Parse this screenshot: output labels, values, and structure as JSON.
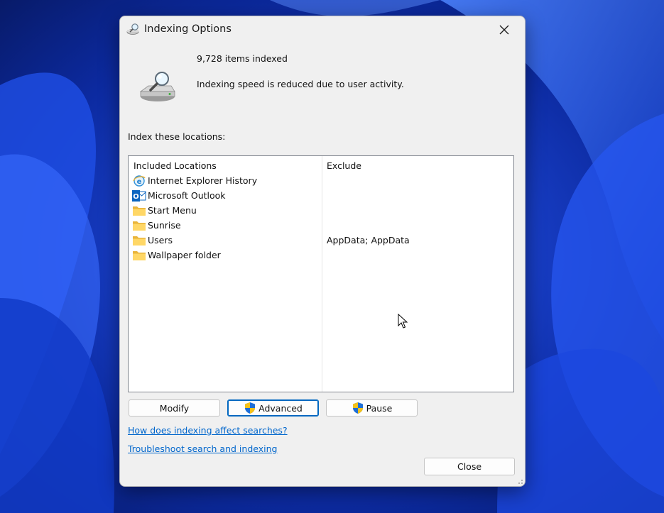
{
  "window": {
    "title": "Indexing Options",
    "icon": "indexing-magnifier-icon"
  },
  "status": {
    "items_indexed": "9,728 items indexed",
    "speed_message": "Indexing speed is reduced due to user activity."
  },
  "locations": {
    "label": "Index these locations:",
    "col_included": "Included Locations",
    "col_exclude": "Exclude",
    "rows": [
      {
        "name": "Internet Explorer History",
        "exclude": "",
        "icon": "internet-explorer-icon"
      },
      {
        "name": "Microsoft Outlook",
        "exclude": "",
        "icon": "outlook-icon"
      },
      {
        "name": "Start Menu",
        "exclude": "",
        "icon": "folder-icon"
      },
      {
        "name": "Sunrise",
        "exclude": "",
        "icon": "folder-icon"
      },
      {
        "name": "Users",
        "exclude": "AppData; AppData",
        "icon": "folder-icon"
      },
      {
        "name": "Wallpaper folder",
        "exclude": "",
        "icon": "folder-icon"
      }
    ]
  },
  "buttons": {
    "modify": "Modify",
    "advanced": "Advanced",
    "pause": "Pause",
    "close": "Close"
  },
  "links": {
    "how_affects": "How does indexing affect searches?",
    "troubleshoot": "Troubleshoot search and indexing"
  },
  "colors": {
    "link": "#0066cc",
    "dialog_bg": "#f0f0f0",
    "focus_border": "#0067c0",
    "wallpaper_blue": "#1a44d8"
  }
}
